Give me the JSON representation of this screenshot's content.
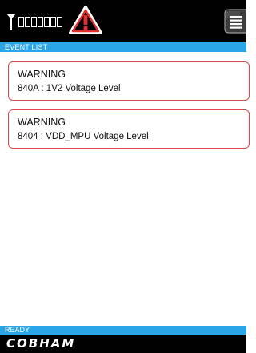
{
  "status_bar": {
    "signal_icon": "antenna-icon",
    "signal_bars_count": 7,
    "alert_icon": "warning-triangle-icon",
    "menu_icon": "menu-list-icon"
  },
  "header": {
    "title": "EVENT LIST"
  },
  "events": [
    {
      "severity": "WARNING",
      "description": "840A : 1V2 Voltage Level"
    },
    {
      "severity": "WARNING",
      "description": "8404 : VDD_MPU Voltage Level"
    }
  ],
  "footer": {
    "status": "READY",
    "brand": "COBHAM"
  },
  "colors": {
    "accent": "#2aa6e8",
    "warning_border": "#e24848",
    "alert_red": "#e03030",
    "background": "#000000"
  }
}
